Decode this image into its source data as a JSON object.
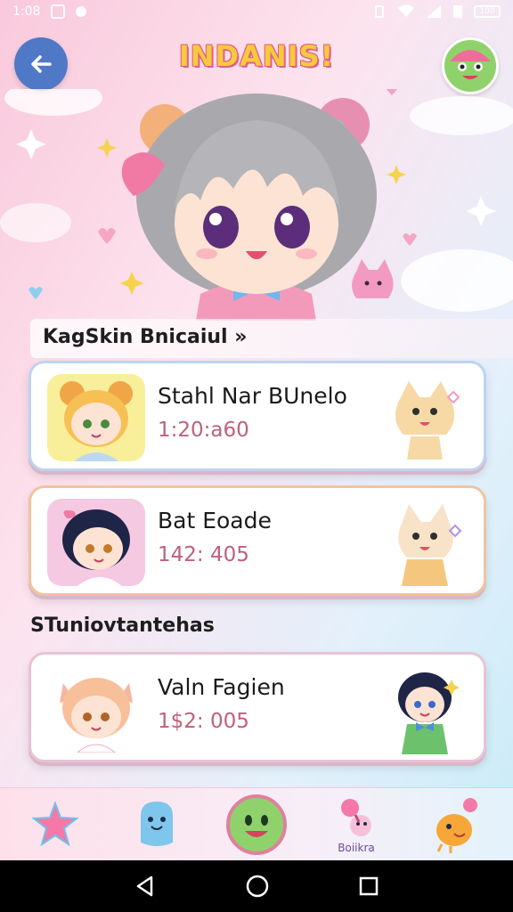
{
  "status_bar": {
    "time": "1:08",
    "battery": "100"
  },
  "header": {
    "title": "INDANIS!"
  },
  "sections": {
    "first": "KagSkin Bnicaiul »",
    "second": "STuniovtantehas"
  },
  "cards": [
    {
      "name": "Stahl Nar BUnelo",
      "value": "1:20:a60"
    },
    {
      "name": "Bat Eoade",
      "value": "142: 405"
    },
    {
      "name": "Valn Fagien",
      "value": "1$2: 005"
    }
  ],
  "bottom_nav": {
    "items": [
      {
        "icon": "star-icon"
      },
      {
        "icon": "monster-icon"
      },
      {
        "icon": "smile-icon"
      },
      {
        "icon": "bunny-icon",
        "label": "Boiikra"
      },
      {
        "icon": "bird-icon"
      }
    ]
  },
  "colors": {
    "accent": "#4f79c7",
    "title": "#f7c93d",
    "value": "#c0607a",
    "pink": "#f6a6c1"
  }
}
